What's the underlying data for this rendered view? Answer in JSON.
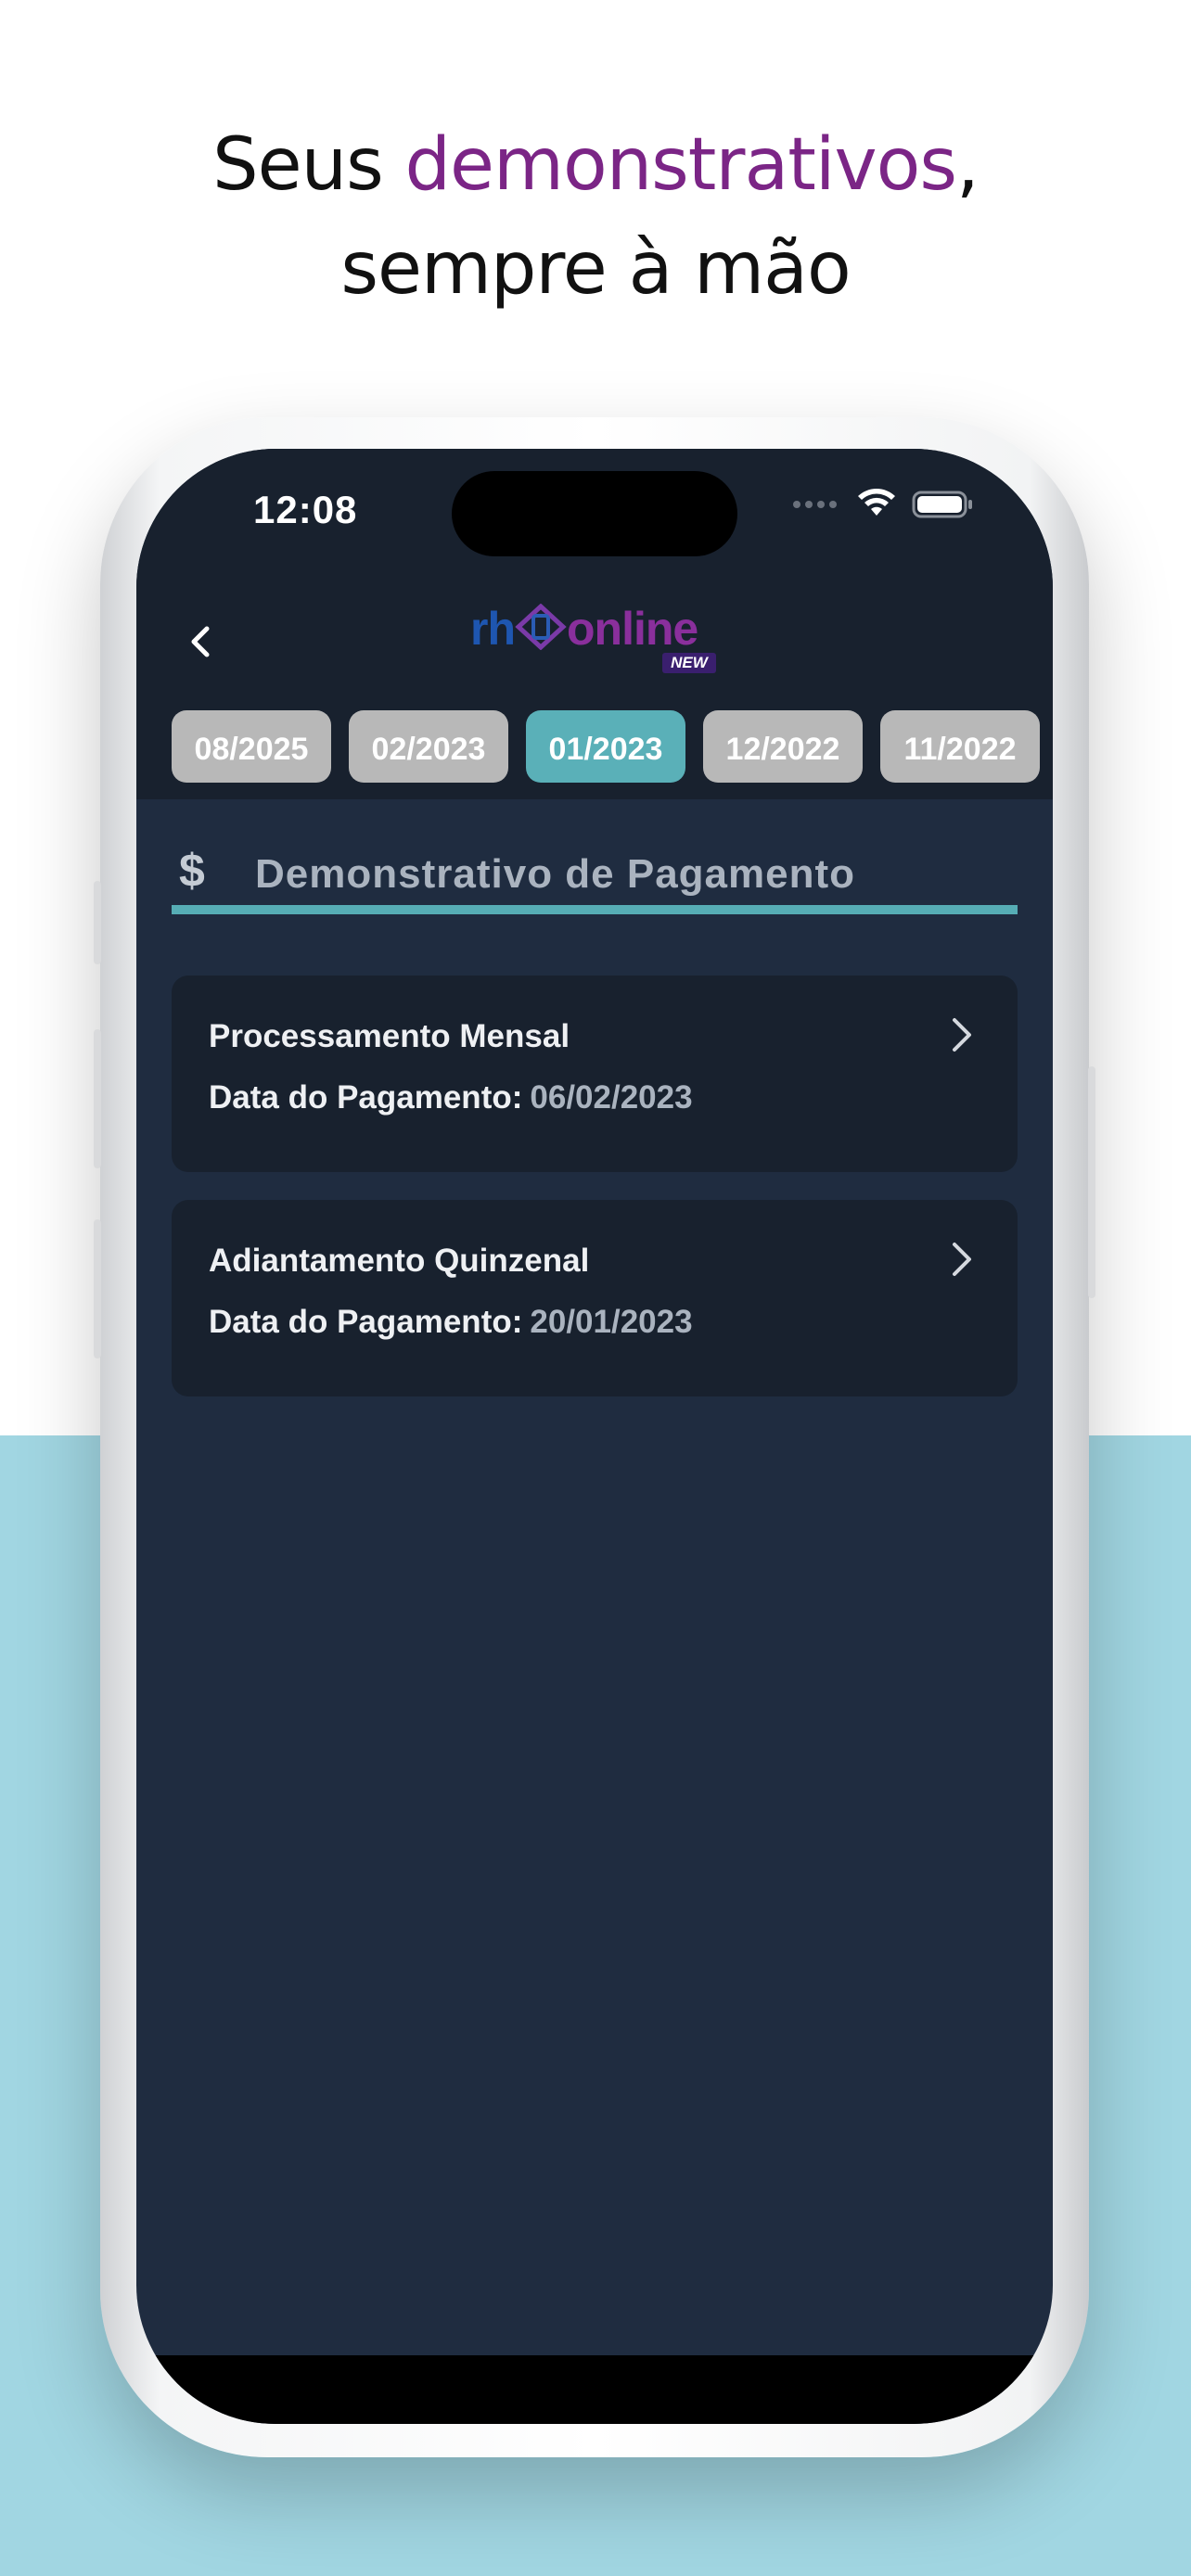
{
  "headline": {
    "part1": "Seus ",
    "accent": "demonstrativos",
    "part2": ",",
    "line2": "sempre à mão"
  },
  "status_bar": {
    "time": "12:08"
  },
  "logo": {
    "rh": "rh",
    "online": "online",
    "badge": "NEW"
  },
  "tabs": [
    {
      "label": "08/2025",
      "active": false
    },
    {
      "label": "02/2023",
      "active": false
    },
    {
      "label": "01/2023",
      "active": true
    },
    {
      "label": "12/2022",
      "active": false
    },
    {
      "label": "11/2022",
      "active": false
    }
  ],
  "section": {
    "icon": "$",
    "title": "Demonstrativo de Pagamento"
  },
  "payments": [
    {
      "title": "Processamento Mensal",
      "date_label": "Data do Pagamento:",
      "date_value": "06/02/2023"
    },
    {
      "title": "Adiantamento Quinzenal",
      "date_label": "Data do Pagamento:",
      "date_value": "20/01/2023"
    }
  ],
  "colors": {
    "accent_purple": "#7b2586",
    "teal": "#5ab0b8",
    "header_bg": "#18212e",
    "screen_bg": "#1f2c40",
    "page_bottom_bg": "#a1d6e2"
  },
  "icons": [
    "chevron-left-icon",
    "dollar-icon",
    "chevron-right-icon",
    "wifi-icon",
    "battery-icon"
  ]
}
